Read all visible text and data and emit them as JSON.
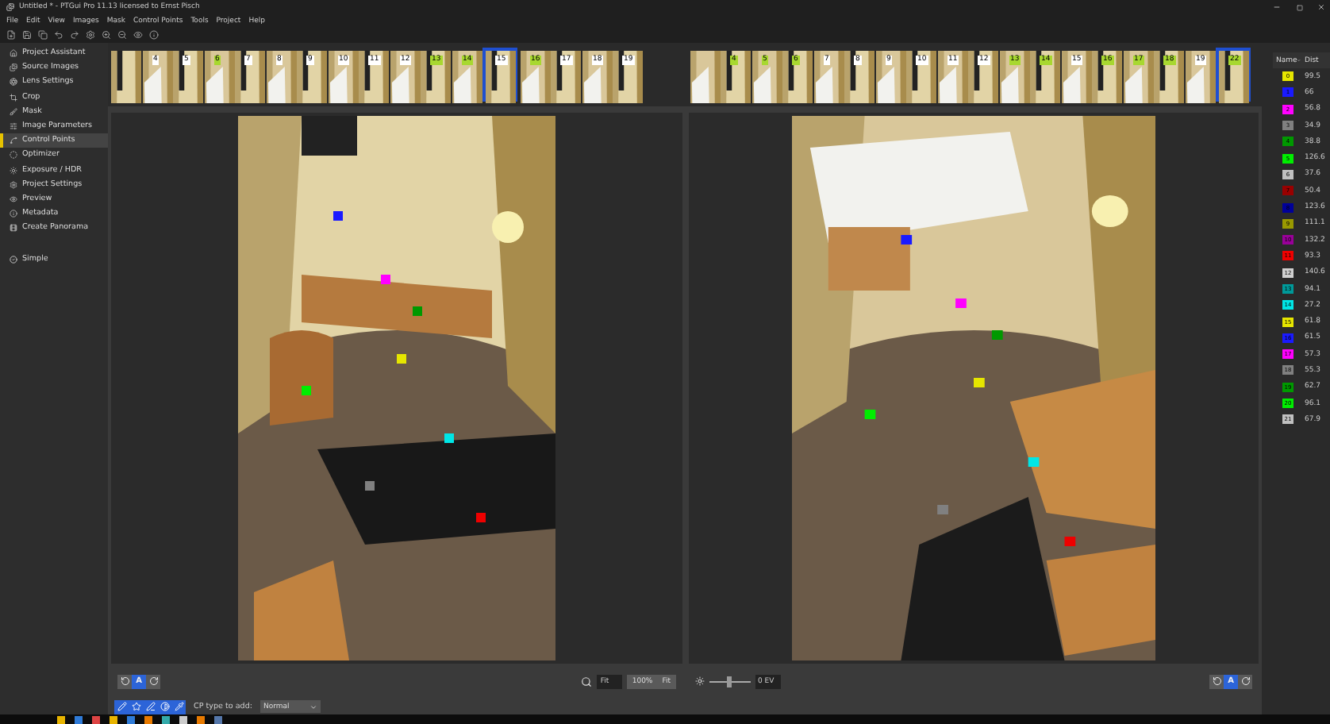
{
  "window": {
    "title": "Untitled * - PTGui Pro 11.13 licensed to Ernst Pisch"
  },
  "menu": [
    "File",
    "Edit",
    "View",
    "Images",
    "Mask",
    "Control Points",
    "Tools",
    "Project",
    "Help"
  ],
  "sidebar": {
    "items": [
      {
        "label": "Project Assistant",
        "selected": false
      },
      {
        "label": "Source Images",
        "selected": false
      },
      {
        "label": "Lens Settings",
        "selected": false
      },
      {
        "label": "Crop",
        "selected": false
      },
      {
        "label": "Mask",
        "selected": false
      },
      {
        "label": "Image Parameters",
        "selected": false
      },
      {
        "label": "Control Points",
        "selected": true
      },
      {
        "label": "Optimizer",
        "selected": false
      },
      {
        "label": "Exposure / HDR",
        "selected": false
      },
      {
        "label": "Project Settings",
        "selected": false
      },
      {
        "label": "Preview",
        "selected": false
      },
      {
        "label": "Metadata",
        "selected": false
      },
      {
        "label": "Create Panorama",
        "selected": false
      }
    ],
    "mode": "Simple"
  },
  "thumbnails_left": [
    {
      "selected": false
    },
    {
      "label": "4",
      "color": "#ffffff",
      "selected": false
    },
    {
      "label": "5",
      "color": "#ffffff",
      "selected": false
    },
    {
      "label": "6",
      "color": "#a8d830",
      "selected": false
    },
    {
      "label": "7",
      "color": "#ffffff",
      "selected": false
    },
    {
      "label": "8",
      "color": "#ffffff",
      "selected": false
    },
    {
      "label": "9",
      "color": "#ffffff",
      "selected": false
    },
    {
      "label": "10",
      "color": "#ffffff",
      "selected": false
    },
    {
      "label": "11",
      "color": "#ffffff",
      "selected": false
    },
    {
      "label": "12",
      "color": "#ffffff",
      "selected": false
    },
    {
      "label": "13",
      "color": "#a8d830",
      "selected": false
    },
    {
      "label": "14",
      "color": "#a8d830",
      "selected": false
    },
    {
      "label": "15",
      "color": "#ffffff",
      "selected": true
    },
    {
      "label": "16",
      "color": "#a8d830",
      "selected": false
    },
    {
      "label": "17",
      "color": "#ffffff",
      "selected": false
    },
    {
      "label": "18",
      "color": "#ffffff",
      "selected": false
    },
    {
      "label": "19",
      "color": "#ffffff",
      "selected": false
    }
  ],
  "thumbnails_right": [
    {
      "selected": false
    },
    {
      "label": "4",
      "color": "#a8d830",
      "selected": false
    },
    {
      "label": "5",
      "color": "#a8d830",
      "selected": false
    },
    {
      "label": "6",
      "color": "#a8d830",
      "selected": false
    },
    {
      "label": "7",
      "color": "#ffffff",
      "selected": false
    },
    {
      "label": "8",
      "color": "#ffffff",
      "selected": false
    },
    {
      "label": "9",
      "color": "#ffffff",
      "selected": false
    },
    {
      "label": "10",
      "color": "#ffffff",
      "selected": false
    },
    {
      "label": "11",
      "color": "#ffffff",
      "selected": false
    },
    {
      "label": "12",
      "color": "#ffffff",
      "selected": false
    },
    {
      "label": "13",
      "color": "#a8d830",
      "selected": false
    },
    {
      "label": "14",
      "color": "#a8d830",
      "selected": false
    },
    {
      "label": "15",
      "color": "#ffffff",
      "selected": false
    },
    {
      "label": "16",
      "color": "#a8d830",
      "selected": false
    },
    {
      "label": "17",
      "color": "#a8d830",
      "selected": false
    },
    {
      "label": "18",
      "color": "#a8d830",
      "selected": false
    },
    {
      "label": "19",
      "color": "#ffffff",
      "selected": false
    },
    {
      "label": "22",
      "color": "#a8d830",
      "selected": true
    }
  ],
  "left_rotate": [
    {
      "kind": "rotate-left",
      "selected": false
    },
    {
      "kind": "auto",
      "label": "A",
      "selected": true
    },
    {
      "kind": "rotate-right",
      "selected": false
    }
  ],
  "right_rotate": [
    {
      "kind": "rotate-left",
      "selected": false
    },
    {
      "kind": "auto",
      "label": "A",
      "selected": true
    },
    {
      "kind": "rotate-right",
      "selected": false
    }
  ],
  "zoom": {
    "value": "Fit",
    "actual_size": "100%",
    "fit": "Fit"
  },
  "exposure": {
    "level": 0.5,
    "value": "0 EV"
  },
  "cp_tools": [
    {
      "kind": "pencil",
      "selected": true
    },
    {
      "kind": "star",
      "selected": true
    },
    {
      "kind": "pen",
      "selected": true
    },
    {
      "kind": "contrast",
      "selected": true
    },
    {
      "kind": "picker",
      "selected": true
    }
  ],
  "cp_type": {
    "label": "CP type to add:",
    "value": "Normal"
  },
  "control_points": {
    "columns": [
      {
        "label": "Name",
        "sorted": true
      },
      {
        "label": "Dist",
        "sorted": false
      }
    ],
    "rows": [
      {
        "name": "0",
        "dist": "99.5",
        "color": "#e6e600"
      },
      {
        "name": "1",
        "dist": "66",
        "color": "#1a1aff"
      },
      {
        "name": "2",
        "dist": "56.8",
        "color": "#ff00ff"
      },
      {
        "name": "3",
        "dist": "34.9",
        "color": "#808080"
      },
      {
        "name": "4",
        "dist": "38.8",
        "color": "#009900"
      },
      {
        "name": "5",
        "dist": "126.6",
        "color": "#00ee00"
      },
      {
        "name": "6",
        "dist": "37.6",
        "color": "#c0c0c0"
      },
      {
        "name": "7",
        "dist": "50.4",
        "color": "#990000"
      },
      {
        "name": "8",
        "dist": "123.6",
        "color": "#000099"
      },
      {
        "name": "9",
        "dist": "111.1",
        "color": "#999900"
      },
      {
        "name": "10",
        "dist": "132.2",
        "color": "#990099"
      },
      {
        "name": "11",
        "dist": "93.3",
        "color": "#ee0000"
      },
      {
        "name": "12",
        "dist": "140.6",
        "color": "#d0d0d0"
      },
      {
        "name": "13",
        "dist": "94.1",
        "color": "#009999"
      },
      {
        "name": "14",
        "dist": "27.2",
        "color": "#00e6e6"
      },
      {
        "name": "15",
        "dist": "61.8",
        "color": "#e6e600"
      },
      {
        "name": "16",
        "dist": "61.5",
        "color": "#1a1aff"
      },
      {
        "name": "17",
        "dist": "57.3",
        "color": "#ff00ff"
      },
      {
        "name": "18",
        "dist": "55.3",
        "color": "#808080"
      },
      {
        "name": "19",
        "dist": "62.7",
        "color": "#009900"
      },
      {
        "name": "20",
        "dist": "96.1",
        "color": "#00ee00"
      },
      {
        "name": "21",
        "dist": "67.9",
        "color": "#c0c0c0"
      }
    ]
  }
}
